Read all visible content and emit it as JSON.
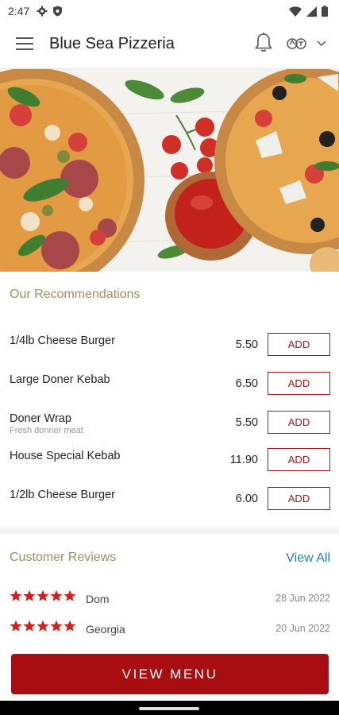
{
  "status_bar": {
    "time": "2:47"
  },
  "app_bar": {
    "title": "Blue Sea Pizzeria"
  },
  "recommendations": {
    "title": "Our Recommendations",
    "add_label": "ADD",
    "items": [
      {
        "name": "1/4lb Cheese Burger",
        "description": "",
        "price": "5.50"
      },
      {
        "name": "Large Doner Kebab",
        "description": "",
        "price": "6.50"
      },
      {
        "name": "Doner Wrap",
        "description": "Fresh donner meat",
        "price": "5.50"
      },
      {
        "name": "House Special Kebab",
        "description": "",
        "price": "11.90"
      },
      {
        "name": "1/2lb Cheese Burger",
        "description": "",
        "price": "6.00"
      }
    ]
  },
  "reviews": {
    "title": "Customer Reviews",
    "view_all": "View All",
    "items": [
      {
        "name": "Dom",
        "date": "28 Jun 2022",
        "rating": 5
      },
      {
        "name": "Georgia",
        "date": "20 Jun 2022",
        "rating": 5
      }
    ]
  },
  "footer": {
    "view_menu_label": "VIEW MENU"
  },
  "colors": {
    "accent": "#a80d12",
    "link": "#2a7bb8",
    "section_title": "#a08e63"
  }
}
